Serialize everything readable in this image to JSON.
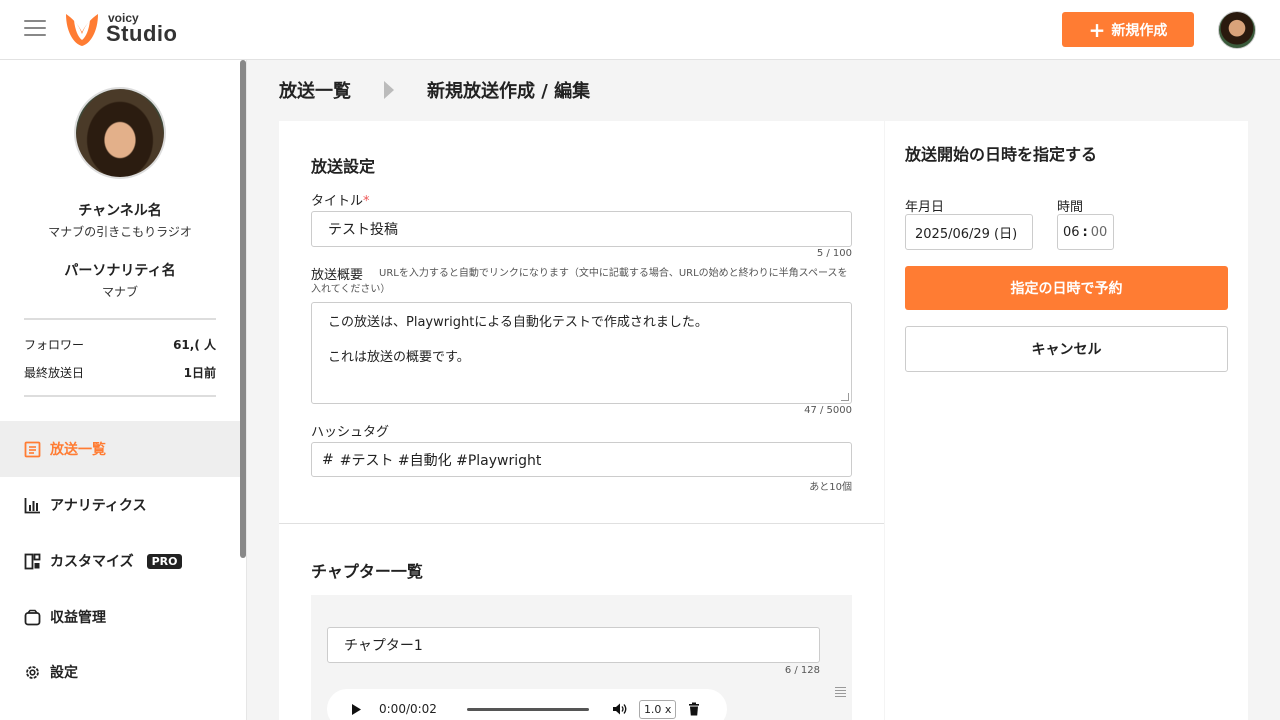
{
  "header": {
    "logo_small": "voicy",
    "logo_big": "Studio",
    "new_button_label": "新規作成",
    "icons": {
      "menu": "hamburger-icon",
      "plus": "plus-icon"
    },
    "accent_color": "#ff7c33"
  },
  "sidebar": {
    "channel_label": "チャンネル名",
    "channel_name": "マナブの引きこもりラジオ",
    "personality_label": "パーソナリティ名",
    "personality_name": "マナブ",
    "stats": [
      {
        "label": "フォロワー",
        "value": "61,(   人"
      },
      {
        "label": "最終放送日",
        "value": "1日前"
      }
    ],
    "nav": [
      {
        "label": "放送一覧",
        "icon": "list-icon",
        "active": true
      },
      {
        "label": "アナリティクス",
        "icon": "analytics-icon",
        "active": false
      },
      {
        "label": "カスタマイズ",
        "icon": "customize-icon",
        "active": false,
        "badge": "PRO"
      },
      {
        "label": "収益管理",
        "icon": "wallet-icon",
        "active": false
      },
      {
        "label": "設定",
        "icon": "gear-icon",
        "active": false
      }
    ]
  },
  "breadcrumb": {
    "parent": "放送一覧",
    "current": "新規放送作成 / 編集"
  },
  "form": {
    "section_title": "放送設定",
    "title_label": "タイトル",
    "title_required_mark": "*",
    "title_value": "テスト投稿",
    "title_counter": "5 / 100",
    "summary_label": "放送概要",
    "summary_hint": "URLを入力すると自動でリンクになります（文中に記載する場合、URLの始めと終わりに半角スペースを入れてください）",
    "summary_line1": "この放送は、Playwrightによる自動化テストで作成されました。",
    "summary_line2": "これは放送の概要です。",
    "summary_counter": "47 / 5000",
    "hashtag_label": "ハッシュタグ",
    "hashtag_prefix": "#",
    "hashtag_value": "#テスト #自動化 #Playwright",
    "hashtag_remaining": "あと10個"
  },
  "chapters": {
    "section_title": "チャプター一覧",
    "items": [
      {
        "title": "チャプター1",
        "counter": "6 / 128",
        "audio_time": "0:00/0:02",
        "speed": "1.0 x"
      }
    ]
  },
  "schedule": {
    "title": "放送開始の日時を指定する",
    "date_label": "年月日",
    "date_value": "2025/06/29 (日)",
    "time_label": "時間",
    "time_hour": "06",
    "time_minute": "00",
    "submit_label": "指定の日時で予約",
    "cancel_label": "キャンセル"
  }
}
